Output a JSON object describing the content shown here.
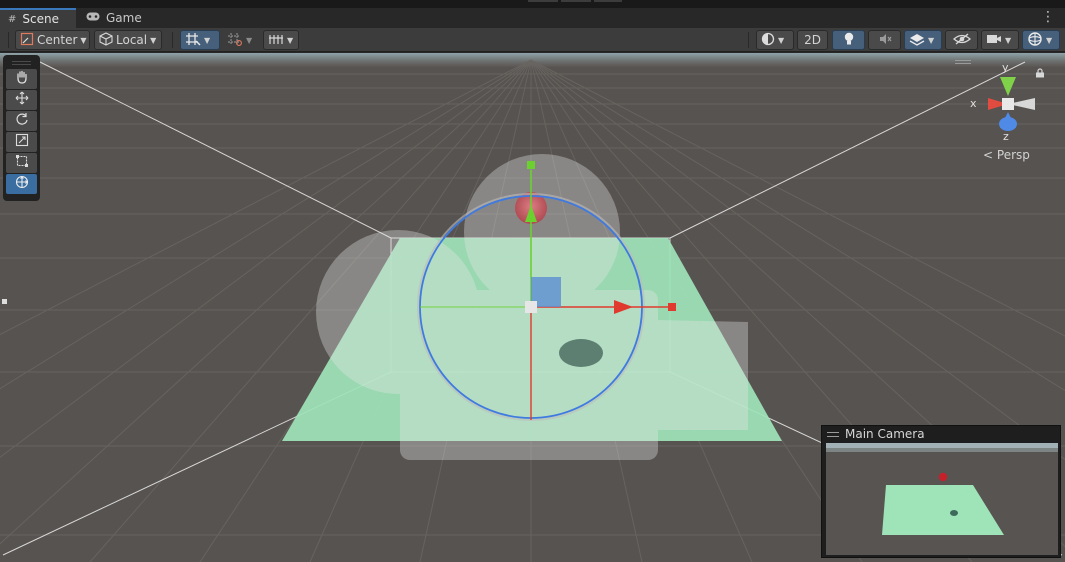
{
  "tabs": [
    {
      "label": "Scene",
      "icon": "grid-icon",
      "active": true
    },
    {
      "label": "Game",
      "icon": "gamepad-icon",
      "active": false
    }
  ],
  "toolbar": {
    "pivot_label": "Center",
    "space_label": "Local",
    "mode_2d_label": "2D"
  },
  "gizmo": {
    "x_label": "x",
    "y_label": "y",
    "z_label": "z",
    "projection_label": "Persp"
  },
  "camera_preview": {
    "title": "Main Camera"
  },
  "colors": {
    "accent": "#3a79bb",
    "plane": "#9be0b4",
    "axis_x": "#e03a2e",
    "axis_y": "#6bd12f",
    "axis_z": "#3f7ae0"
  }
}
